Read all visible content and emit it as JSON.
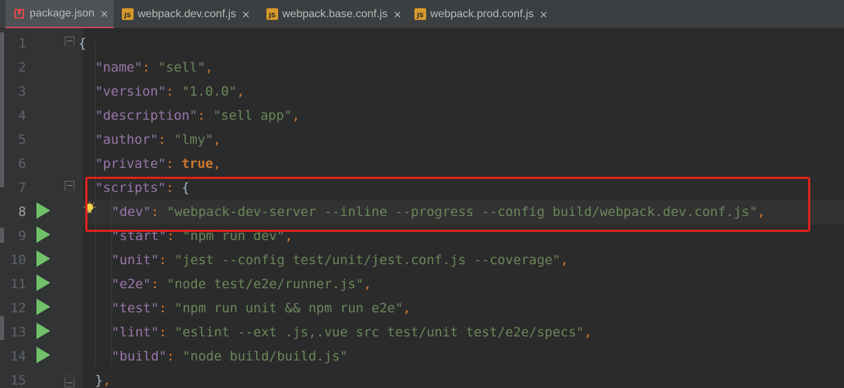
{
  "tabs": [
    {
      "label": "package.json",
      "icon": "json-file-icon",
      "active": true
    },
    {
      "label": "webpack.dev.conf.js",
      "icon": "js-file-icon",
      "active": false
    },
    {
      "label": "webpack.base.conf.js",
      "icon": "js-file-icon",
      "active": false
    },
    {
      "label": "webpack.prod.conf.js",
      "icon": "js-file-icon",
      "active": false
    }
  ],
  "tab_close_glyph": "×",
  "js_badge": "JS",
  "line_numbers": [
    "1",
    "2",
    "3",
    "4",
    "5",
    "6",
    "7",
    "8",
    "9",
    "10",
    "11",
    "12",
    "13",
    "14",
    "15"
  ],
  "current_line": "8",
  "code": {
    "l1": {
      "brace": "{"
    },
    "l2": {
      "key": "\"name\"",
      "colon": ": ",
      "value": "\"sell\"",
      "comma": ","
    },
    "l3": {
      "key": "\"version\"",
      "colon": ": ",
      "value": "\"1.0.0\"",
      "comma": ","
    },
    "l4": {
      "key": "\"description\"",
      "colon": ": ",
      "value": "\"sell app\"",
      "comma": ","
    },
    "l5": {
      "key": "\"author\"",
      "colon": ": ",
      "value": "\"lmy\"",
      "comma": ","
    },
    "l6": {
      "key": "\"private\"",
      "colon": ": ",
      "value": "true",
      "comma": ","
    },
    "l7": {
      "key": "\"scripts\"",
      "colon": ": ",
      "value": "{"
    },
    "l8": {
      "key": "\"dev\"",
      "colon": ": ",
      "value": "\"webpack-dev-server --inline --progress --config build/webpack.dev.conf.js\"",
      "comma": ","
    },
    "l9": {
      "key": "\"start\"",
      "colon": ": ",
      "value": "\"npm run dev\"",
      "comma": ","
    },
    "l10": {
      "key": "\"unit\"",
      "colon": ": ",
      "value": "\"jest --config test/unit/jest.conf.js --coverage\"",
      "comma": ","
    },
    "l11": {
      "key": "\"e2e\"",
      "colon": ": ",
      "value": "\"node test/e2e/runner.js\"",
      "comma": ","
    },
    "l12": {
      "key": "\"test\"",
      "colon": ": ",
      "value": "\"npm run unit && npm run e2e\"",
      "comma": ","
    },
    "l13": {
      "key": "\"lint\"",
      "colon": ": ",
      "value": "\"eslint --ext .js,.vue src test/unit test/e2e/specs\"",
      "comma": ","
    },
    "l14": {
      "key": "\"build\"",
      "colon": ": ",
      "value": "\"node build/build.js\""
    },
    "l15": {
      "brace": "}",
      "comma": ","
    }
  },
  "colors": {
    "background": "#2b2b2b",
    "key": "#9876aa",
    "string": "#6a8759",
    "keyword": "#cc7832",
    "run_icon": "#6fc26a",
    "highlight_box": "#e6231a"
  }
}
